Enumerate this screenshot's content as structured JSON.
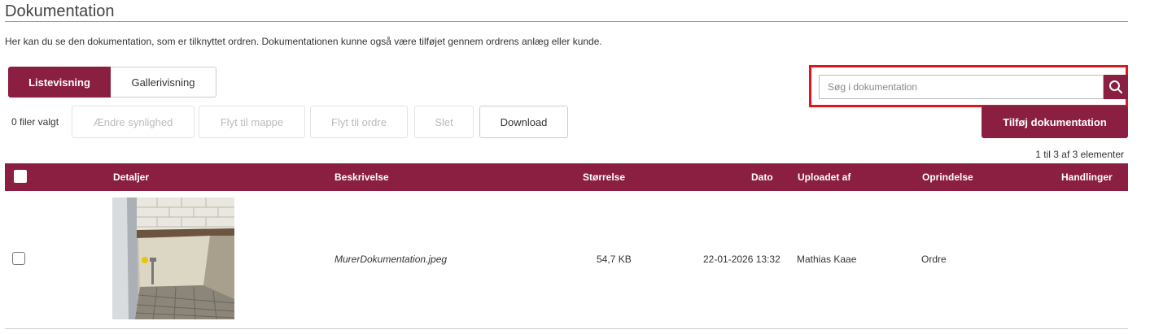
{
  "page": {
    "title": "Dokumentation",
    "intro": "Her kan du se den dokumentation, som er tilknyttet ordren. Dokumentationen kunne også være tilføjet gennem ordrens anlæg eller kunde."
  },
  "view_tabs": {
    "list": "Listevisning",
    "gallery": "Gallerivisning",
    "active": "list"
  },
  "search": {
    "placeholder": "Søg i dokumentation",
    "value": "",
    "icon": "search-icon"
  },
  "toolbar": {
    "selected_count": "0 filer valgt",
    "change_visibility": "Ændre synlighed",
    "move_to_folder": "Flyt til mappe",
    "move_to_order": "Flyt til ordre",
    "delete": "Slet",
    "download": "Download",
    "add_documentation": "Tilføj dokumentation"
  },
  "pager": "1 til 3 af 3 elementer",
  "table": {
    "columns": [
      "Detaljer",
      "Beskrivelse",
      "Størrelse",
      "Dato",
      "Uploadet af",
      "Oprindelse",
      "Handlinger"
    ],
    "rows": [
      {
        "description": "MurerDokumentation.jpeg",
        "size": "54,7 KB",
        "date": "22-01-2026 13:32",
        "uploaded_by": "Mathias Kaae",
        "origin": "Ordre"
      }
    ]
  },
  "colors": {
    "accent": "#8b1f42",
    "highlight": "#e0161e"
  }
}
